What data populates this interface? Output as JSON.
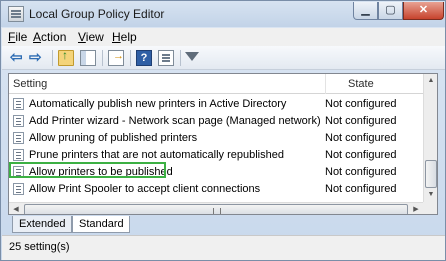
{
  "window": {
    "title": "Local Group Policy Editor",
    "min_glyph": "▁",
    "max_glyph": "▢",
    "close_glyph": "✕"
  },
  "menu": {
    "items": [
      {
        "label": "File",
        "accel": "F",
        "rest": "ile"
      },
      {
        "label": "Action",
        "accel": "A",
        "rest": "ction"
      },
      {
        "label": "View",
        "accel": "V",
        "rest": "iew"
      },
      {
        "label": "Help",
        "accel": "H",
        "rest": "elp"
      }
    ]
  },
  "toolbar": {
    "icons": [
      "back-arrow-icon",
      "forward-arrow-icon",
      "up-folder-icon",
      "show-hide-console-tree-icon",
      "export-list-icon",
      "help-icon",
      "properties-icon",
      "filter-icon"
    ],
    "back_glyph": "⇦",
    "forward_glyph": "⇨",
    "help_glyph": "?"
  },
  "list": {
    "columns": {
      "setting": "Setting",
      "state": "State"
    },
    "rows": [
      {
        "name": "Automatically publish new printers in Active Directory",
        "state": "Not configured"
      },
      {
        "name": "Add Printer wizard - Network scan page (Managed network)",
        "state": "Not configured"
      },
      {
        "name": "Allow pruning of published printers",
        "state": "Not configured"
      },
      {
        "name": "Prune printers that are not automatically republished",
        "state": "Not configured"
      },
      {
        "name": "Allow printers to be published",
        "state": "Not configured"
      },
      {
        "name": "Allow Print Spooler to accept client connections",
        "state": "Not configured"
      }
    ],
    "highlighted_row": "Allow printers to be published",
    "highlight_color": "#3cb043",
    "scroll_up_glyph": "▲",
    "scroll_down_glyph": "▼",
    "scroll_left_glyph": "◀",
    "scroll_right_glyph": "▶"
  },
  "tabs": {
    "extended": "Extended",
    "standard": "Standard",
    "active": "Standard"
  },
  "status": {
    "text": "25 setting(s)"
  }
}
